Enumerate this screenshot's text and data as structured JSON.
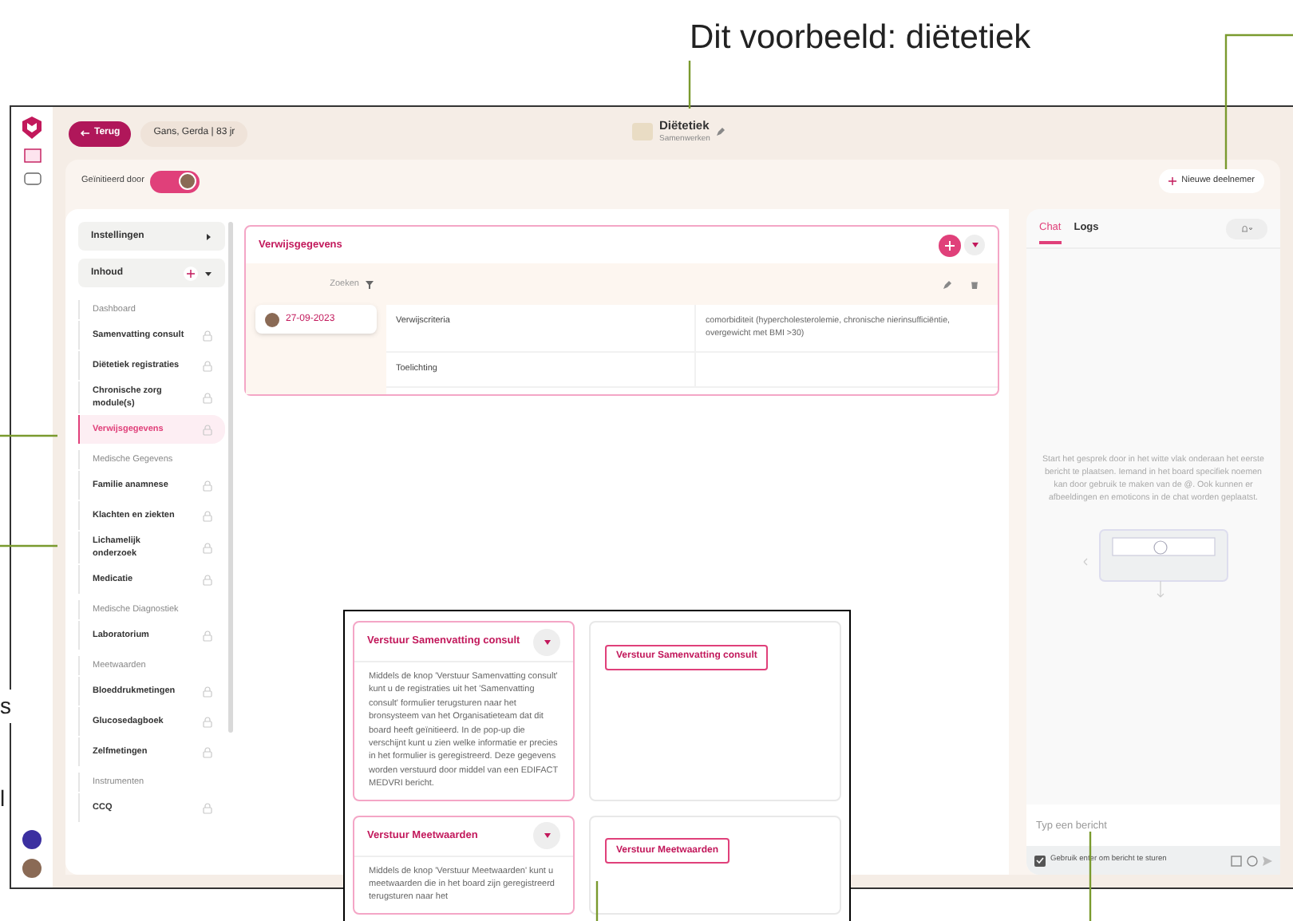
{
  "annotation": {
    "title": "Dit voorbeeld: diëtetiek",
    "fragments": [
      "s",
      "l"
    ]
  },
  "header": {
    "back_button": "Terug",
    "patient": "Gans, Gerda | 83 jr",
    "board_title": "Diëtetiek",
    "board_subtitle": "Samenwerken",
    "initiated_by": "Geïnitieerd door",
    "new_participant": "Nieuwe deelnemer"
  },
  "sidebar": {
    "items": [
      {
        "kind": "toggle",
        "label": "Instellingen",
        "expanded": false,
        "add": false
      },
      {
        "kind": "toggle",
        "label": "Inhoud",
        "expanded": true,
        "add": true
      },
      {
        "kind": "section",
        "label": "Dashboard"
      },
      {
        "kind": "item",
        "label": "Samenvatting consult",
        "selected": false
      },
      {
        "kind": "item",
        "label": "Diëtetiek registraties",
        "selected": false
      },
      {
        "kind": "item",
        "label": "Chronische zorg module(s)",
        "selected": false
      },
      {
        "kind": "item",
        "label": "Verwijsgegevens",
        "selected": true
      },
      {
        "kind": "section",
        "label": "Medische Gegevens"
      },
      {
        "kind": "item",
        "label": "Familie anamnese",
        "selected": false
      },
      {
        "kind": "item",
        "label": "Klachten en ziekten",
        "selected": false
      },
      {
        "kind": "item",
        "label": "Lichamelijk onderzoek",
        "selected": false
      },
      {
        "kind": "item",
        "label": "Medicatie",
        "selected": false
      },
      {
        "kind": "section",
        "label": "Medische Diagnostiek"
      },
      {
        "kind": "item",
        "label": "Laboratorium",
        "selected": false
      },
      {
        "kind": "section",
        "label": "Meetwaarden"
      },
      {
        "kind": "item",
        "label": "Bloeddrukmetingen",
        "selected": false
      },
      {
        "kind": "item",
        "label": "Glucosedagboek",
        "selected": false
      },
      {
        "kind": "item",
        "label": "Zelfmetingen",
        "selected": false
      },
      {
        "kind": "section",
        "label": "Instrumenten"
      },
      {
        "kind": "item",
        "label": "CCQ",
        "selected": false
      }
    ]
  },
  "panel": {
    "title": "Verwijsgegevens",
    "search": "Zoeken",
    "date": "27-09-2023",
    "rows": [
      {
        "label": "Verwijscriteria",
        "value": "comorbiditeit (hypercholesterolemie, chronische nierinsufficiëntie, overgewicht met BMI >30)"
      },
      {
        "label": "Toelichting",
        "value": ""
      }
    ]
  },
  "chat": {
    "tabs": [
      {
        "label": "Chat",
        "selected": true
      },
      {
        "label": "Logs",
        "selected": false
      }
    ],
    "empty_text": "Start het gesprek door in het witte vlak onderaan het eerste bericht te plaatsen. Iemand in het board specifiek noemen kan door gebruik te maken van de @. Ook kunnen er afbeeldingen en emoticons in de chat worden geplaatst.",
    "placeholder": "Typ een bericht",
    "enter_option": {
      "label": "Gebruik enter om bericht te sturen",
      "checked": true
    }
  },
  "inset": {
    "cards": [
      {
        "title": "Verstuur Samenvatting consult",
        "text": "Middels de knop 'Verstuur Samenvatting consult' kunt u de registraties uit het 'Samenvatting consult' formulier terugsturen naar het bronsysteem van het Organisatieteam dat dit board heeft geïnitieerd. In de pop-up die verschijnt kunt u zien welke informatie er precies in het formulier is geregistreerd. Deze gegevens worden verstuurd door middel van een EDIFACT MEDVRI bericht.",
        "button": "Verstuur Samenvatting consult"
      },
      {
        "title": "Verstuur Meetwaarden",
        "text": "Middels de knop 'Verstuur Meetwaarden' kunt u meetwaarden die in het board zijn geregistreerd terugsturen naar het",
        "button": "Verstuur Meetwaarden"
      }
    ]
  }
}
